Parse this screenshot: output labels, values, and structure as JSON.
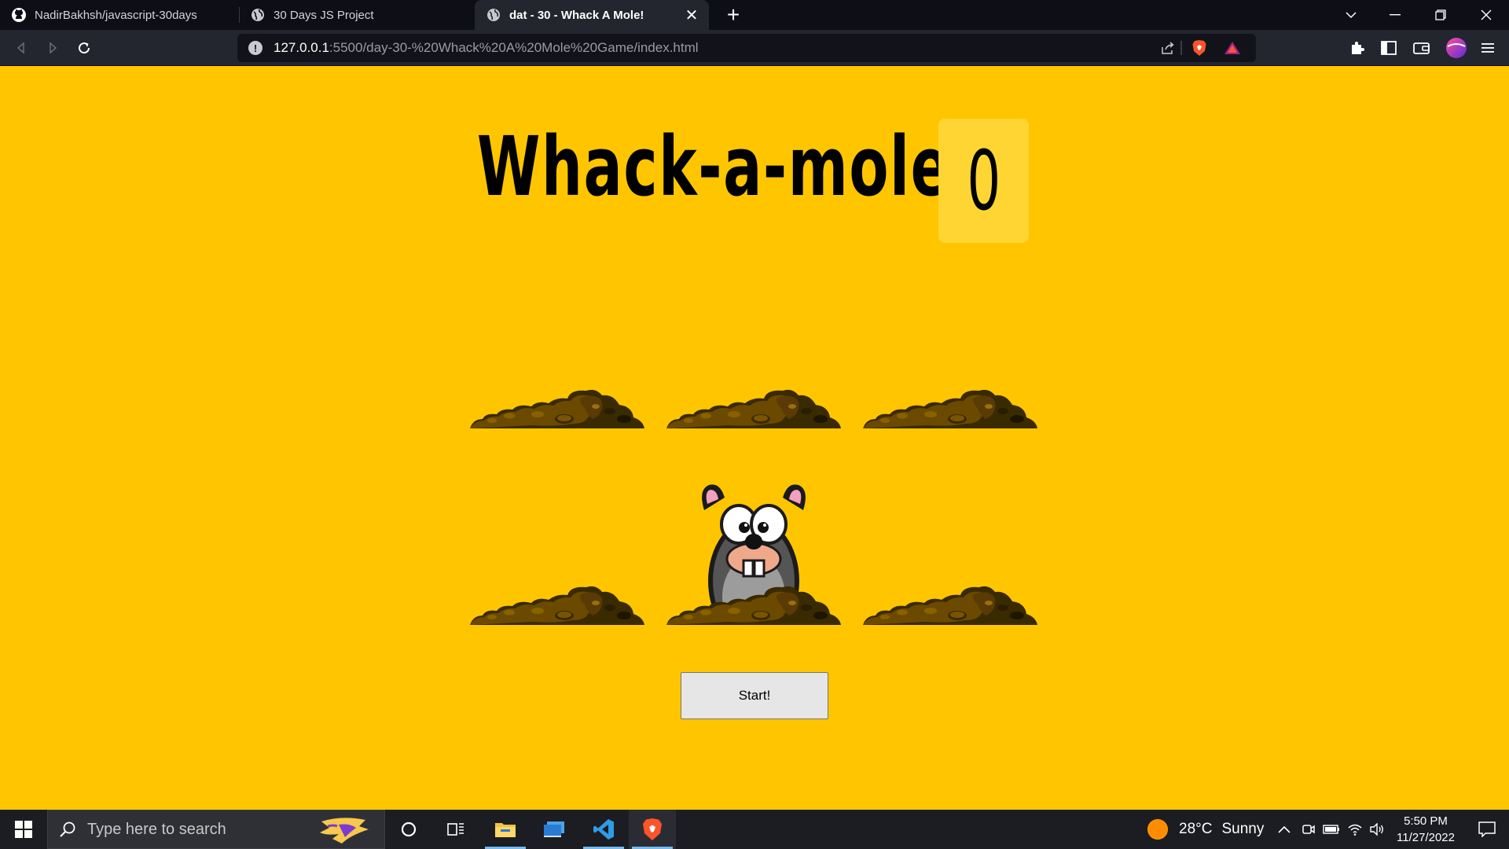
{
  "browser": {
    "tabs": [
      {
        "title": "NadirBakhsh/javascript-30days",
        "icon": "github-icon"
      },
      {
        "title": "30 Days JS Project",
        "icon": "globe-icon"
      },
      {
        "title": "dat - 30 - Whack A Mole!",
        "icon": "globe-icon",
        "active": true
      }
    ],
    "url_host": "127.0.0.1",
    "url_path": ":5500/day-30-%20Whack%20A%20Mole%20Game/index.html"
  },
  "game": {
    "title": "Whack-a-mole!",
    "score": "0",
    "holes_count": 6,
    "mole_hole_index": 4,
    "start_label": "Start!"
  },
  "taskbar": {
    "search_placeholder": "Type here to search",
    "weather_temp": "28°C",
    "weather_desc": "Sunny",
    "time": "5:50 PM",
    "date": "11/27/2022"
  },
  "colors": {
    "page_background": "#ffc600",
    "score_box": "#ffd533",
    "tabbar": "#0d0e16",
    "toolbar": "#23252f",
    "taskbar": "#1c1d22"
  }
}
